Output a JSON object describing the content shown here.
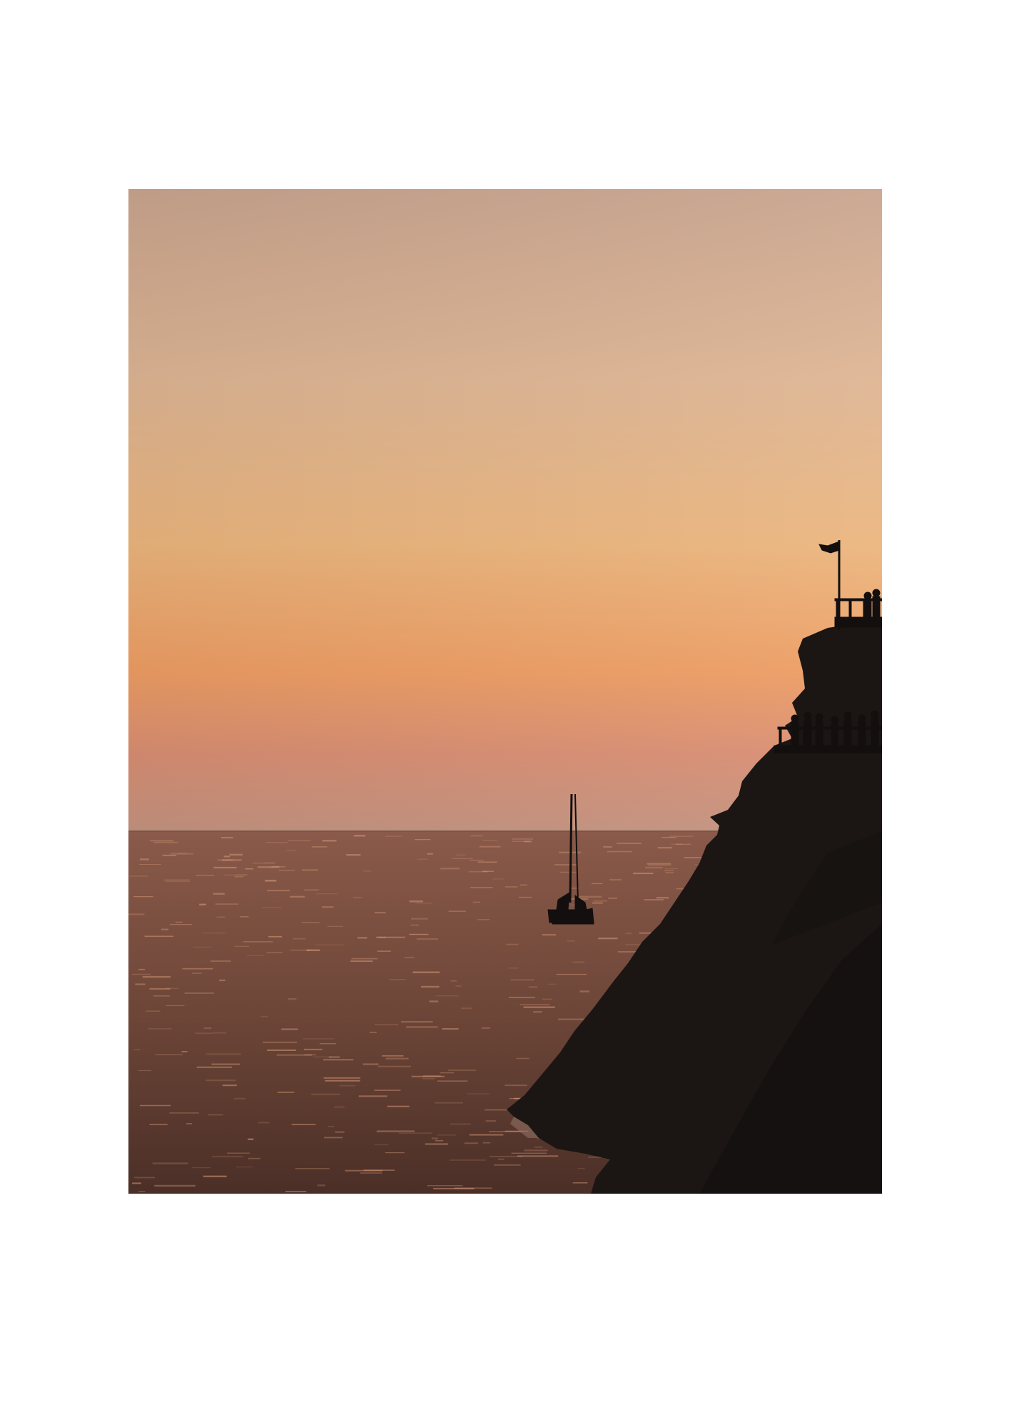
{
  "page": {
    "background": "#ffffff"
  },
  "photo": {
    "subject": "sunset-seascape",
    "colors": {
      "sky_top": "#c9a48e",
      "sky_upper": "#deb593",
      "sky_mid": "#ebb57d",
      "sky_glow": "#ee9d63",
      "sky_low": "#d98e73",
      "sky_horizon": "#c4937f",
      "sea_top": "#8a5a4a",
      "sea_mid": "#6d4638",
      "sea_bottom": "#4b2f27",
      "sea_sparkle": "#e8a882",
      "cliff": "#1b1614",
      "cliff_shade": "#261c18",
      "silhouette": "#120f0e"
    },
    "elements": [
      "sky-gradient",
      "sea",
      "sailboat-icon",
      "rocky-cliff",
      "flag-icon",
      "viewing-railing",
      "people-silhouettes"
    ]
  }
}
